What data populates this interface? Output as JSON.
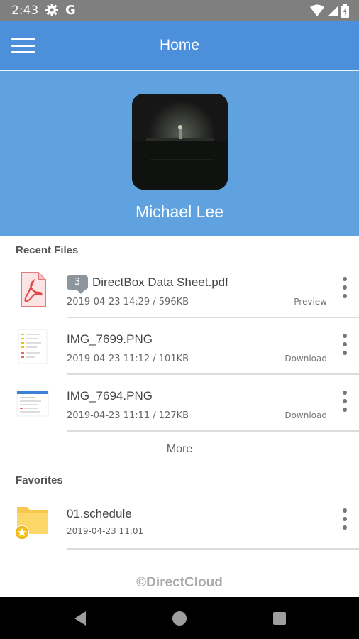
{
  "status_bar": {
    "time": "2:43",
    "g_label": "G"
  },
  "app_bar": {
    "title": "Home"
  },
  "profile": {
    "name": "Michael Lee"
  },
  "recent_files": {
    "heading": "Recent Files",
    "items": [
      {
        "badge": "3",
        "name": "DirectBox Data Sheet.pdf",
        "meta": "2019-04-23 14:29 / 596KB",
        "action": "Preview",
        "icon": "pdf-icon"
      },
      {
        "name": "IMG_7699.PNG",
        "meta": "2019-04-23 11:12 / 101KB",
        "action": "Download",
        "icon": "image-thumbnail"
      },
      {
        "name": "IMG_7694.PNG",
        "meta": "2019-04-23 11:11 / 127KB",
        "action": "Download",
        "icon": "image-thumbnail"
      }
    ],
    "more_label": "More"
  },
  "favorites": {
    "heading": "Favorites",
    "items": [
      {
        "name": "01.schedule",
        "meta": "2019-04-23 11:01",
        "icon": "starred-folder-icon"
      }
    ]
  },
  "footer": {
    "copyright": "©DirectCloud"
  },
  "colors": {
    "app_bar": "#4c8fdb",
    "profile_bg": "#60a2df",
    "status_bar": "#7f7f7f"
  }
}
